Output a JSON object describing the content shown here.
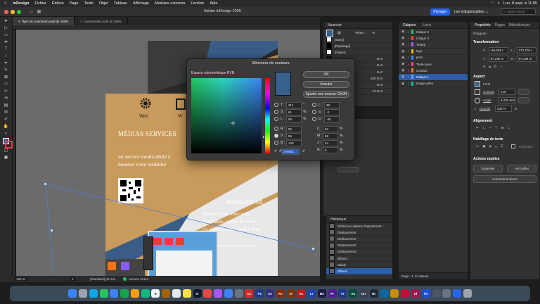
{
  "menubar": {
    "apple": "",
    "items": [
      "InDesign",
      "Fichier",
      "Édition",
      "Page",
      "Texte",
      "Objet",
      "Tableau",
      "Affichage",
      "Modules externes",
      "Fenêtre",
      "Aide"
    ],
    "clock": "Lun. 8 sept. à 11:55"
  },
  "app": {
    "title": "Adobe InDesign 2025",
    "share_label": "Partager",
    "workspace": "Les indispensables",
    "search_placeholder": "Adobe Stock"
  },
  "tabs": [
    {
      "label": "flyer A6 comcentro.indd @ 183%",
      "active": true
    },
    {
      "label": "cartesvisites.indd @ 166%",
      "active": false
    }
  ],
  "flyer": {
    "web1": "Web",
    "web2": "W",
    "services_title": "MÉDIAS SERVICES",
    "services_text1": "un service media dédié à",
    "services_text2": "boostez votre visibilité",
    "prestations_title": "PRESTATIONS",
    "prestations_lines": [
      "Nous créons sites web,",
      "brochures, cartes de visite,",
      "cv, vidéos, post-production"
    ],
    "url": "www.com-centro.ch"
  },
  "swatches_panel": {
    "tab": "Nuancier",
    "tint_label": "Teinte :",
    "tint_value": "%",
    "items": [
      {
        "name": "[Sans]",
        "color": "#ffffff"
      },
      {
        "name": "[Repérage]",
        "color": "#000000"
      },
      {
        "name": "[Papier]",
        "color": "#ffffff"
      },
      {
        "name": "",
        "color": "#111111"
      },
      {
        "name": "",
        "color": "#e11d48"
      },
      {
        "name": "",
        "color": "#facc15"
      },
      {
        "name": "",
        "color": "#2563eb"
      },
      {
        "name": "",
        "color": "#0ea5e9"
      },
      {
        "name": "",
        "color": "#6b7280"
      }
    ],
    "codes": [
      "N=0",
      "N=0",
      "N=0",
      "100 N=0",
      "N=0",
      "10 N=0"
    ]
  },
  "layers_panel": {
    "tabs": [
      "Calques",
      "Liens"
    ],
    "items": [
      {
        "name": "Calque 2",
        "color": "#22c55e",
        "selected": false
      },
      {
        "name": "Calque 3",
        "color": "#ef4444",
        "selected": false
      },
      {
        "name": "Textep",
        "color": "#a855f7",
        "selected": false
      },
      {
        "name": "logo",
        "color": "#eab308",
        "selected": false
      },
      {
        "name": "picto",
        "color": "#3b82f6",
        "selected": false
      },
      {
        "name": "Texte pavé",
        "color": "#ec4899",
        "selected": false
      },
      {
        "name": "Contact",
        "color": "#f97316",
        "selected": false
      },
      {
        "name": "Calque 1",
        "color": "#60a5fa",
        "selected": true
      },
      {
        "name": "image video",
        "color": "#14b8a6",
        "selected": false
      }
    ],
    "footer": "Page : 1, 9 calques"
  },
  "history_panel": {
    "title": "Historique",
    "items": [
      "Définir les options d'ajustement...",
      "Déplacement",
      "Déplacement",
      "Déplacement",
      "Déplacement",
      "Effacer",
      "Saisie",
      "Effacer"
    ]
  },
  "properties": {
    "tabs": [
      "Propriétés",
      "Pages",
      "Bibliothèques"
    ],
    "object_type": "Polygone",
    "transform_title": "Transformation",
    "x_label": "X :",
    "x_value": "-45,329 r",
    "y_label": "Y :",
    "y_value": "67,232 m",
    "l_label": "L :",
    "l_value": "172,279 r",
    "h_label": "H :",
    "h_value": "57,138 m",
    "appearance_title": "Aspect",
    "fill_label": "Fond",
    "stroke_label": "Contour",
    "stroke_value": "0 pt",
    "angle_label": "Angle",
    "angle_value": "4,233 mm",
    "opacity_label": "Opacité",
    "opacity_value": "100 %",
    "align_title": "Alignement",
    "wrap_title": "Habillage de texte",
    "wrap_option": "Réduction",
    "quick_title": "Actions rapides",
    "btn_group": "Organiser",
    "btn_lock": "Verrouiller",
    "btn_convert": "Convertir la forme"
  },
  "color_picker": {
    "title": "Sélecteur de couleurs",
    "space_label": "Espace colorimétrique RVB",
    "ok": "OK",
    "cancel": "Annuler",
    "add_cmyk": "Ajouter une nuance CMJN",
    "h_label": "T :",
    "h_value": "211",
    "h_unit": "°",
    "s_label": "S :",
    "s_value": "61",
    "s_unit": "%",
    "l_label": "L :",
    "l_value": "55",
    "l_unit": "%",
    "r_label": "R :",
    "r_value": "55",
    "g_label": "V :",
    "g_value": "96",
    "b_label": "B :",
    "b_value": "140",
    "lab_l_label": "L :",
    "lab_l_value": "39",
    "lab_a_label": "a :",
    "lab_a_value": "-3",
    "lab_b_label": "b :",
    "lab_b_value": "-30",
    "c_label": "C :",
    "c_value": "84",
    "c_unit": "%",
    "m_label": "M :",
    "m_value": "58",
    "m_unit": "%",
    "y_label": "J :",
    "y_value": "24",
    "y_unit": "%",
    "k_label": "N :",
    "k_value": "8",
    "k_unit": "%",
    "hex_label": "#",
    "hex_value": "37608C",
    "preview_color": "#37608c"
  },
  "statusbar": {
    "zoom": "183,11",
    "page": "1",
    "style": "[Standard] (de tra...",
    "errors": "Aucune erreur"
  },
  "dock": {
    "icons": [
      {
        "name": "finder",
        "color": "#3b82f6",
        "text": ""
      },
      {
        "name": "launchpad",
        "color": "#9ca3af",
        "text": ""
      },
      {
        "name": "safari",
        "color": "#0ea5e9",
        "text": ""
      },
      {
        "name": "messages",
        "color": "#22c55e",
        "text": ""
      },
      {
        "name": "mail",
        "color": "#3b82f6",
        "text": ""
      },
      {
        "name": "maps",
        "color": "#16a34a",
        "text": ""
      },
      {
        "name": "photos",
        "color": "#f59e0b",
        "text": ""
      },
      {
        "name": "facetime",
        "color": "#10b981",
        "text": ""
      },
      {
        "name": "calendar",
        "color": "#f3f4f6",
        "text": "8"
      },
      {
        "name": "contacts",
        "color": "#a16207",
        "text": ""
      },
      {
        "name": "reminders",
        "color": "#e5e7eb",
        "text": ""
      },
      {
        "name": "notes",
        "color": "#fde047",
        "text": ""
      },
      {
        "name": "tv",
        "color": "#111827",
        "text": "tv"
      },
      {
        "name": "music",
        "color": "#ef4444",
        "text": ""
      },
      {
        "name": "podcasts",
        "color": "#a855f7",
        "text": ""
      },
      {
        "name": "appstore",
        "color": "#3b82f6",
        "text": ""
      },
      {
        "name": "settings",
        "color": "#6b7280",
        "text": ""
      },
      {
        "name": "creative-cloud",
        "color": "#dc2626",
        "text": "Cc"
      },
      {
        "name": "photoshop",
        "color": "#1e3a8a",
        "text": "Ps"
      },
      {
        "name": "after-effects",
        "color": "#312e81",
        "text": "Ae"
      },
      {
        "name": "animate",
        "color": "#7c2d12",
        "text": "An"
      },
      {
        "name": "illustrator",
        "color": "#78350f",
        "text": "Ai"
      },
      {
        "name": "acrobat",
        "color": "#b91c1c",
        "text": "Ac"
      },
      {
        "name": "lightroom",
        "color": "#1e40af",
        "text": "Lr"
      },
      {
        "name": "media-encoder",
        "color": "#1e1b4b",
        "text": "Me"
      },
      {
        "name": "premiere",
        "color": "#4c1d95",
        "text": "Pr"
      },
      {
        "name": "fresco",
        "color": "#1e3a8a",
        "text": "Fr"
      },
      {
        "name": "audition",
        "color": "#064e3b",
        "text": "Au"
      },
      {
        "name": "dimension",
        "color": "#374151",
        "text": "Dn"
      },
      {
        "name": "bridge",
        "color": "#1f2937",
        "text": "Br"
      },
      {
        "name": "app-a",
        "color": "#0369a1",
        "text": ""
      },
      {
        "name": "app-b",
        "color": "#ca8a04",
        "text": ""
      },
      {
        "name": "app-c",
        "color": "#be123c",
        "text": ""
      },
      {
        "name": "indesign",
        "color": "#9d174d",
        "text": "Id"
      },
      {
        "name": "photoshop-2",
        "color": "#1d4ed8",
        "text": "Ps"
      },
      {
        "name": "app-d",
        "color": "#4b5563",
        "text": ""
      },
      {
        "name": "app-e",
        "color": "#6b7280",
        "text": ""
      },
      {
        "name": "downloads",
        "color": "#2563eb",
        "text": ""
      },
      {
        "name": "trash",
        "color": "#9ca3af",
        "text": ""
      }
    ]
  }
}
